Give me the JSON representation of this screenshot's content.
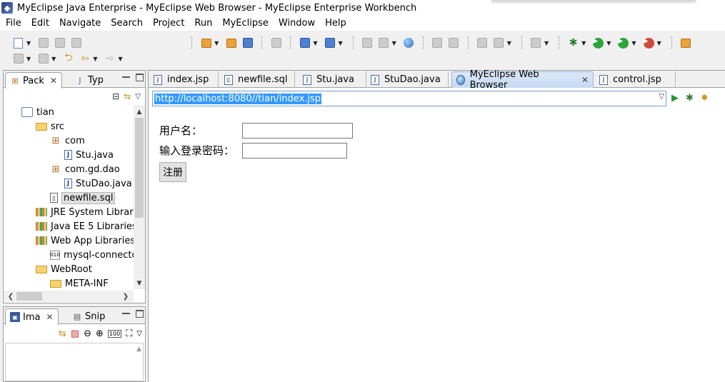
{
  "window": {
    "title": "MyEclipse Java Enterprise - MyEclipse Web Browser - MyEclipse Enterprise Workbench"
  },
  "menu": [
    "File",
    "Edit",
    "Navigate",
    "Search",
    "Project",
    "Run",
    "MyEclipse",
    "Window",
    "Help"
  ],
  "package_explorer": {
    "tab_label": "Pack",
    "other_tab_label": "Typ",
    "tree": [
      {
        "label": "tian",
        "icon": "project-icon",
        "expanded": true
      },
      {
        "label": "src",
        "icon": "source-folder-icon",
        "expanded": true
      },
      {
        "label": "com",
        "icon": "package-icon",
        "expanded": true
      },
      {
        "label": "Stu.java",
        "icon": "java-file-icon"
      },
      {
        "label": "com.gd.dao",
        "icon": "package-icon",
        "expanded": true
      },
      {
        "label": "StuDao.java",
        "icon": "java-file-icon"
      },
      {
        "label": "newfile.sql",
        "icon": "sql-file-icon",
        "selected": true
      },
      {
        "label": "JRE System Library",
        "icon": "library-icon"
      },
      {
        "label": "Java EE 5 Libraries",
        "icon": "library-icon"
      },
      {
        "label": "Web App Libraries",
        "icon": "library-icon",
        "expanded": true
      },
      {
        "label": "mysql-connector",
        "icon": "jar-icon"
      },
      {
        "label": "WebRoot",
        "icon": "folder-icon",
        "expanded": true
      },
      {
        "label": "META-INF",
        "icon": "folder-icon"
      }
    ]
  },
  "image_view": {
    "tab_label": "Ima",
    "other_tab_label": "Snip",
    "zoom_label": "100"
  },
  "editor": {
    "tabs": [
      {
        "label": "index.jsp",
        "active": false
      },
      {
        "label": "newfile.sql",
        "active": false
      },
      {
        "label": "Stu.java",
        "active": false
      },
      {
        "label": "StuDao.java",
        "active": false
      },
      {
        "label": "MyEclipse Web Browser",
        "active": true
      },
      {
        "label": "control.jsp",
        "active": false
      }
    ],
    "url": "http://localhost:8080//tian/index.jsp"
  },
  "form": {
    "username_label": "用户名：",
    "username_value": "",
    "password_label": "输入登录密码：",
    "password_value": "",
    "submit_label": "注册"
  },
  "colors": {
    "url_highlight": "#3399ff",
    "active_tab": "#c6d9f1",
    "go_button": "#1f9a33"
  }
}
